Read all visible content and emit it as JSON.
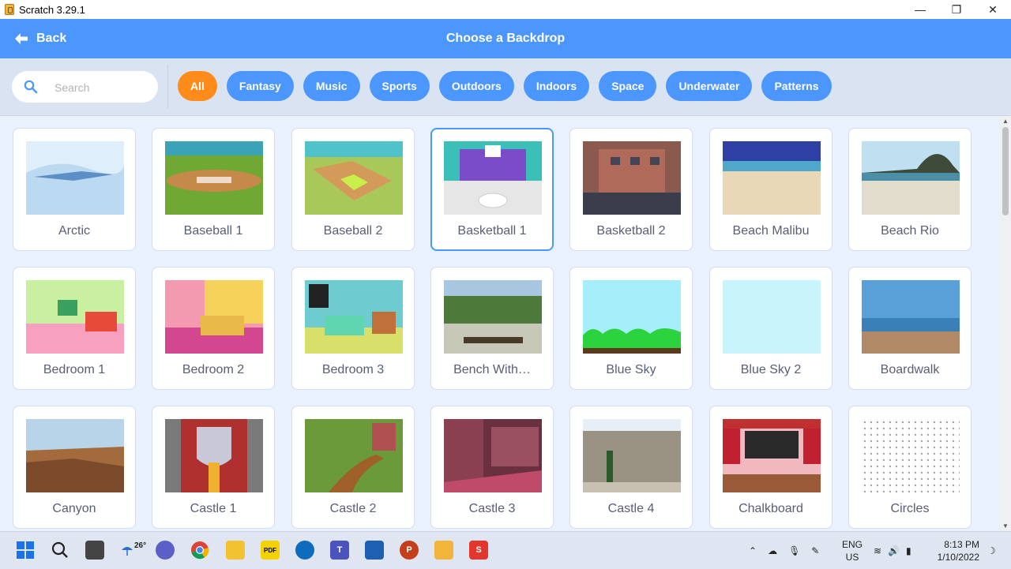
{
  "window": {
    "title": "Scratch 3.29.1"
  },
  "header": {
    "back_label": "Back",
    "title": "Choose a Backdrop"
  },
  "search": {
    "placeholder": "Search"
  },
  "tags": [
    "All",
    "Fantasy",
    "Music",
    "Sports",
    "Outdoors",
    "Indoors",
    "Space",
    "Underwater",
    "Patterns"
  ],
  "active_tag": "All",
  "backdrops": [
    "Arctic",
    "Baseball 1",
    "Baseball 2",
    "Basketball 1",
    "Basketball 2",
    "Beach Malibu",
    "Beach Rio",
    "Bedroom 1",
    "Bedroom 2",
    "Bedroom 3",
    "Bench With…",
    "Blue Sky",
    "Blue Sky 2",
    "Boardwalk",
    "Canyon",
    "Castle 1",
    "Castle 2",
    "Castle 3",
    "Castle 4",
    "Chalkboard",
    "Circles"
  ],
  "selected_backdrop": "Basketball 1",
  "taskbar": {
    "weather_temp": "26°",
    "lang_line1": "ENG",
    "lang_line2": "US",
    "time": "8:13 PM",
    "date": "1/10/2022"
  },
  "colors": {
    "accent": "#4c97ff",
    "active_tag": "#ff8c1a",
    "text": "#575e75"
  }
}
